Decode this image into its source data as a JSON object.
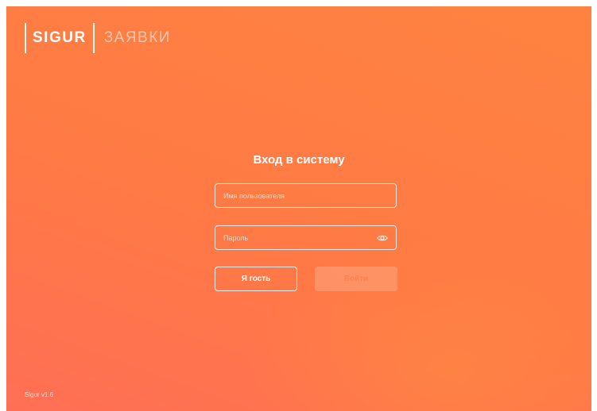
{
  "header": {
    "brand": "SIGUR",
    "app_name": "ЗАЯВКИ"
  },
  "login": {
    "title": "Вход в систему",
    "username_placeholder": "Имя пользователя",
    "password_placeholder": "Пароль",
    "guest_button": "Я гость",
    "login_button": "Войти",
    "password_toggle_icon": "eye-icon"
  },
  "footer": {
    "version": "Sigur v1.6"
  },
  "colors": {
    "background_start": "#ff6f55",
    "background_end": "#ff8340",
    "text": "#ffffff"
  }
}
